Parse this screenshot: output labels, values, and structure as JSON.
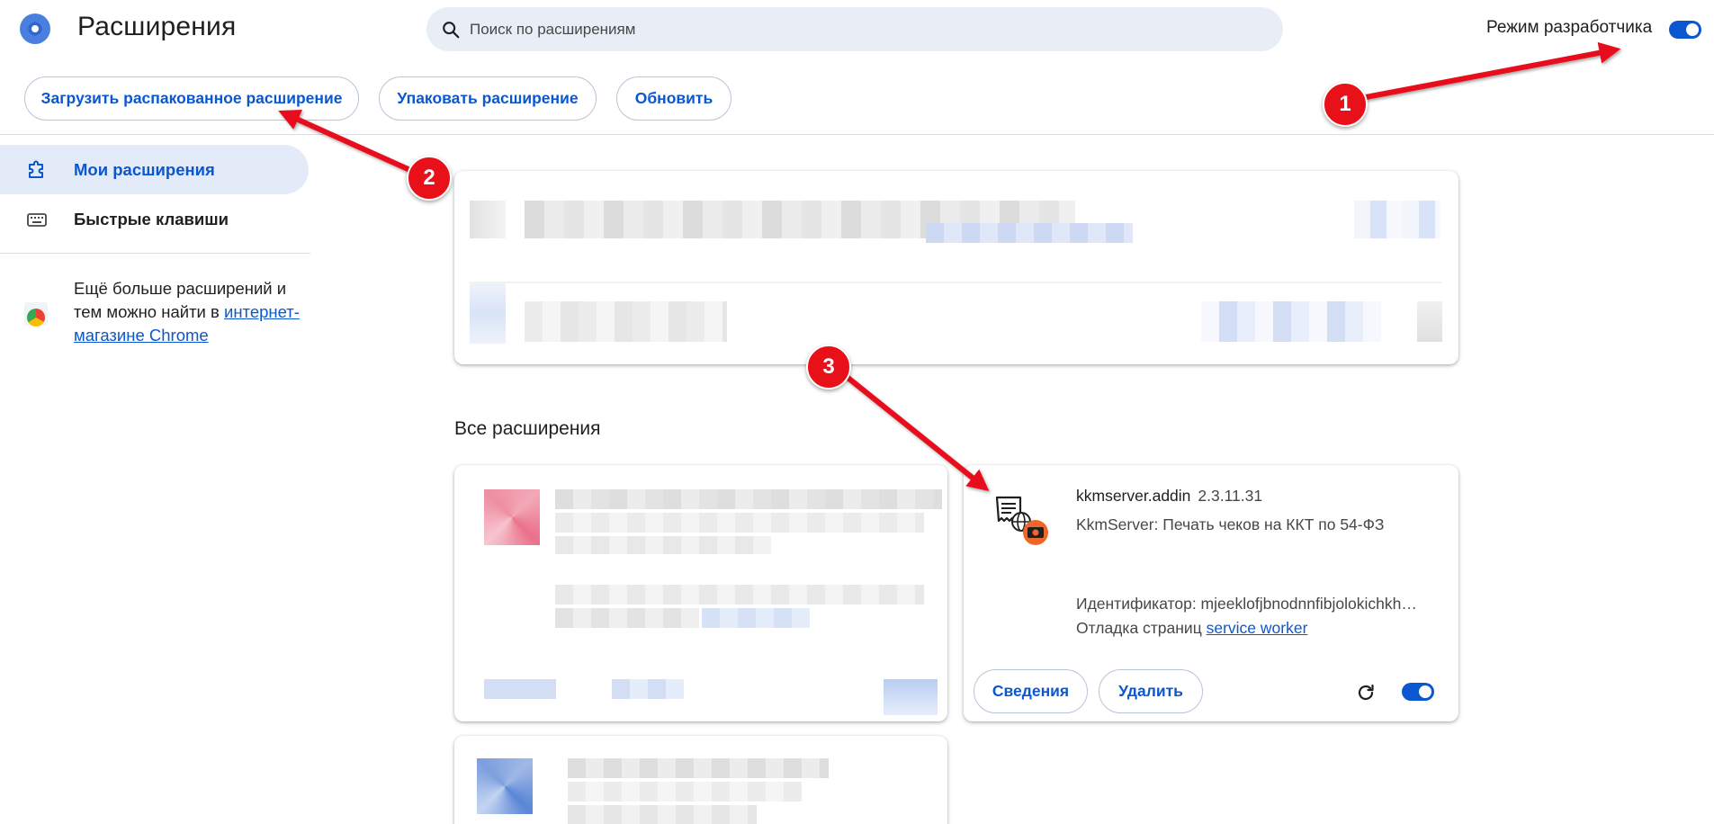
{
  "header": {
    "title": "Расширения",
    "search_placeholder": "Поиск по расширениям",
    "developer_mode_label": "Режим разработчика",
    "developer_mode_on": true
  },
  "toolbar": {
    "load_unpacked": "Загрузить распакованное расширение",
    "pack_extension": "Упаковать расширение",
    "update": "Обновить"
  },
  "sidebar": {
    "items": [
      {
        "label": "Мои расширения",
        "icon": "puzzle-icon",
        "active": true
      },
      {
        "label": "Быстрые клавиши",
        "icon": "keyboard-icon",
        "active": false
      }
    ],
    "store_text": "Ещё больше расширений и тем можно найти в",
    "store_link": "интернет-магазине Chrome"
  },
  "main": {
    "section_title": "Все расширения",
    "extension": {
      "name": "kkmserver.addin",
      "version": "2.3.11.31",
      "description": "KkmServer: Печать чеков на ККТ по 54-ФЗ",
      "id_text": "Идентификатор: mjeeklofjbnodnnfibjolokichkh…",
      "debug_label": "Отладка страниц",
      "debug_link": "service worker",
      "details_button": "Сведения",
      "remove_button": "Удалить",
      "enabled": true
    }
  },
  "annotations": [
    "1",
    "2",
    "3"
  ],
  "colors": {
    "accent": "#0b57d0",
    "annotation": "#e8111a"
  }
}
